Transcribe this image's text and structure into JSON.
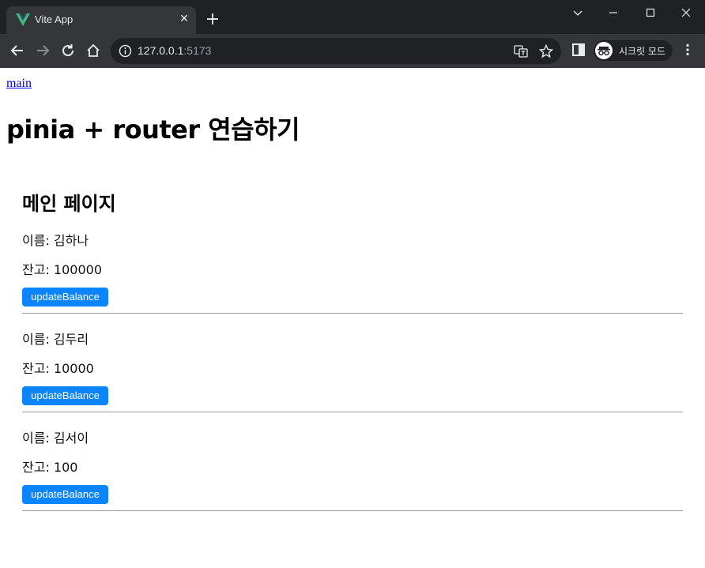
{
  "browser": {
    "tab_title": "Vite App",
    "url_host": "127.0.0.1",
    "url_port": ":5173",
    "incognito_label": "시크릿 모드"
  },
  "page": {
    "nav_link": "main",
    "heading": "pinia + router 연습하기",
    "section_title": "메인 페이지",
    "users": [
      {
        "name_line": "이름: 김하나",
        "balance_line": "잔고: 100000",
        "button": "updateBalance"
      },
      {
        "name_line": "이름: 김두리",
        "balance_line": "잔고: 10000",
        "button": "updateBalance"
      },
      {
        "name_line": "이름: 김서이",
        "balance_line": "잔고: 100",
        "button": "updateBalance"
      }
    ]
  },
  "colors": {
    "button_bg": "#0a84ff",
    "link": "#0000ee",
    "chrome_dark": "#202124",
    "chrome_toolbar": "#35363a"
  }
}
